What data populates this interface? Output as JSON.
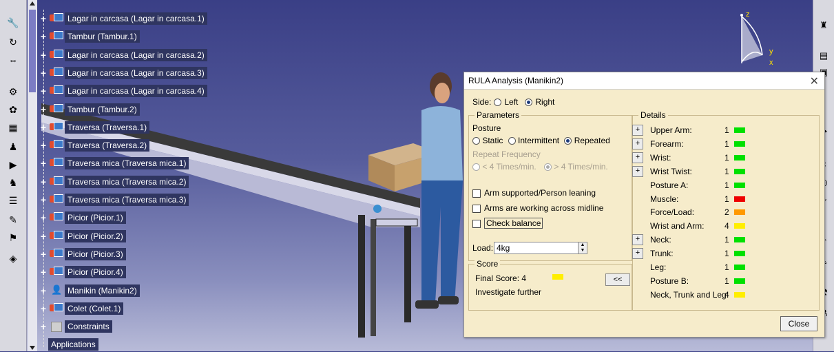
{
  "tree": {
    "items": [
      {
        "label": "Lagar in carcasa (Lagar in carcasa.1)",
        "icon": "part-icon"
      },
      {
        "label": "Tambur (Tambur.1)",
        "icon": "part-icon"
      },
      {
        "label": "Lagar in carcasa (Lagar in carcasa.2)",
        "icon": "part-icon"
      },
      {
        "label": "Lagar in carcasa (Lagar in carcasa.3)",
        "icon": "part-icon"
      },
      {
        "label": "Lagar in carcasa (Lagar in carcasa.4)",
        "icon": "part-icon"
      },
      {
        "label": "Tambur (Tambur.2)",
        "icon": "part-icon"
      },
      {
        "label": "Traversa (Traversa.1)",
        "icon": "part-icon"
      },
      {
        "label": "Traversa (Traversa.2)",
        "icon": "part-icon"
      },
      {
        "label": "Traversa mica (Traversa mica.1)",
        "icon": "part-icon"
      },
      {
        "label": "Traversa mica (Traversa mica.2)",
        "icon": "part-icon"
      },
      {
        "label": "Traversa mica (Traversa mica.3)",
        "icon": "part-icon"
      },
      {
        "label": "Picior (Picior.1)",
        "icon": "part-icon"
      },
      {
        "label": "Picior (Picior.2)",
        "icon": "part-icon"
      },
      {
        "label": "Picior (Picior.3)",
        "icon": "part-icon"
      },
      {
        "label": "Picior (Picior.4)",
        "icon": "part-icon"
      },
      {
        "label": "Manikin (Manikin2)",
        "icon": "manikin-icon"
      },
      {
        "label": "Colet (Colet.1)",
        "icon": "part-icon"
      },
      {
        "label": "Constraints",
        "icon": "constraints-icon"
      },
      {
        "label": "Applications",
        "icon": "none"
      }
    ]
  },
  "axis": {
    "z": "z",
    "y": "y",
    "x": "x"
  },
  "dialog": {
    "title": "RULA Analysis (Manikin2)",
    "close_glyph": "✕",
    "side_label": "Side:",
    "side_left": "Left",
    "side_right": "Right",
    "parameters": {
      "title": "Parameters",
      "posture_label": "Posture",
      "static": "Static",
      "intermittent": "Intermittent",
      "repeated": "Repeated",
      "repeat_freq_label": "Repeat Frequency",
      "freq_low": "< 4 Times/min.",
      "freq_high": "> 4 Times/min.",
      "arm_supported": "Arm supported/Person leaning",
      "arms_midline": "Arms are working across midline",
      "check_balance": "Check balance",
      "load_label": "Load:",
      "load_value": "4kg"
    },
    "score": {
      "title": "Score",
      "final_score": "Final Score: 4",
      "final_color": "#ffee00",
      "recommendation": "Investigate further",
      "collapse_button": "<<"
    },
    "details": {
      "title": "Details",
      "rows": [
        {
          "label": "Upper Arm:",
          "value": "1",
          "color": "#00e000",
          "expandable": true
        },
        {
          "label": "Forearm:",
          "value": "1",
          "color": "#00e000",
          "expandable": true
        },
        {
          "label": "Wrist:",
          "value": "1",
          "color": "#00e000",
          "expandable": true
        },
        {
          "label": "Wrist Twist:",
          "value": "1",
          "color": "#00e000",
          "expandable": true
        },
        {
          "label": "Posture A:",
          "value": "1",
          "color": "#00e000",
          "expandable": false
        },
        {
          "label": "Muscle:",
          "value": "1",
          "color": "#ee0000",
          "expandable": false
        },
        {
          "label": "Force/Load:",
          "value": "2",
          "color": "#ff9900",
          "expandable": false
        },
        {
          "label": "Wrist and Arm:",
          "value": "4",
          "color": "#ffee00",
          "expandable": false
        },
        {
          "label": "Neck:",
          "value": "1",
          "color": "#00e000",
          "expandable": true
        },
        {
          "label": "Trunk:",
          "value": "1",
          "color": "#00e000",
          "expandable": true
        },
        {
          "label": "Leg:",
          "value": "1",
          "color": "#00e000",
          "expandable": false
        },
        {
          "label": "Posture B:",
          "value": "1",
          "color": "#00e000",
          "expandable": false
        },
        {
          "label": "Neck, Trunk and Leg:",
          "value": "4",
          "color": "#ffee00",
          "expandable": false
        }
      ]
    },
    "close_button": "Close"
  }
}
